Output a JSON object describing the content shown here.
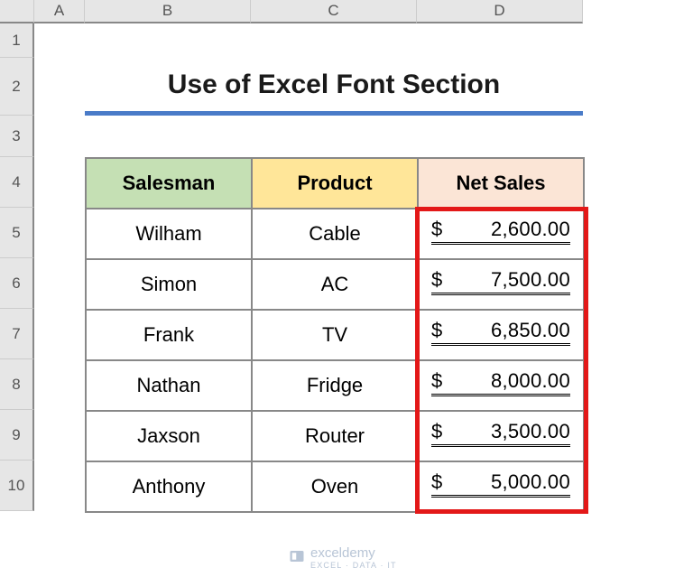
{
  "columns": {
    "A": "A",
    "B": "B",
    "C": "C",
    "D": "D"
  },
  "rows": {
    "r1": "1",
    "r2": "2",
    "r3": "3",
    "r4": "4",
    "r5": "5",
    "r6": "6",
    "r7": "7",
    "r8": "8",
    "r9": "9",
    "r10": "10"
  },
  "title": "Use of Excel Font Section",
  "headers": {
    "salesman": "Salesman",
    "product": "Product",
    "netsales": "Net Sales"
  },
  "currency": "$",
  "data": [
    {
      "salesman": "Wilham",
      "product": "Cable",
      "net": "2,600.00"
    },
    {
      "salesman": "Simon",
      "product": "AC",
      "net": "7,500.00"
    },
    {
      "salesman": "Frank",
      "product": "TV",
      "net": "6,850.00"
    },
    {
      "salesman": "Nathan",
      "product": "Fridge",
      "net": "8,000.00"
    },
    {
      "salesman": "Jaxson",
      "product": "Router",
      "net": "3,500.00"
    },
    {
      "salesman": "Anthony",
      "product": "Oven",
      "net": "5,000.00"
    }
  ],
  "watermark": {
    "brand": "exceldemy",
    "tagline": "EXCEL · DATA · IT"
  },
  "chart_data": {
    "type": "table",
    "title": "Use of Excel Font Section",
    "columns": [
      "Salesman",
      "Product",
      "Net Sales"
    ],
    "rows": [
      [
        "Wilham",
        "Cable",
        2600.0
      ],
      [
        "Simon",
        "AC",
        7500.0
      ],
      [
        "Frank",
        "TV",
        6850.0
      ],
      [
        "Nathan",
        "Fridge",
        8000.0
      ],
      [
        "Jaxson",
        "Router",
        3500.0
      ],
      [
        "Anthony",
        "Oven",
        5000.0
      ]
    ],
    "currency": "USD"
  }
}
